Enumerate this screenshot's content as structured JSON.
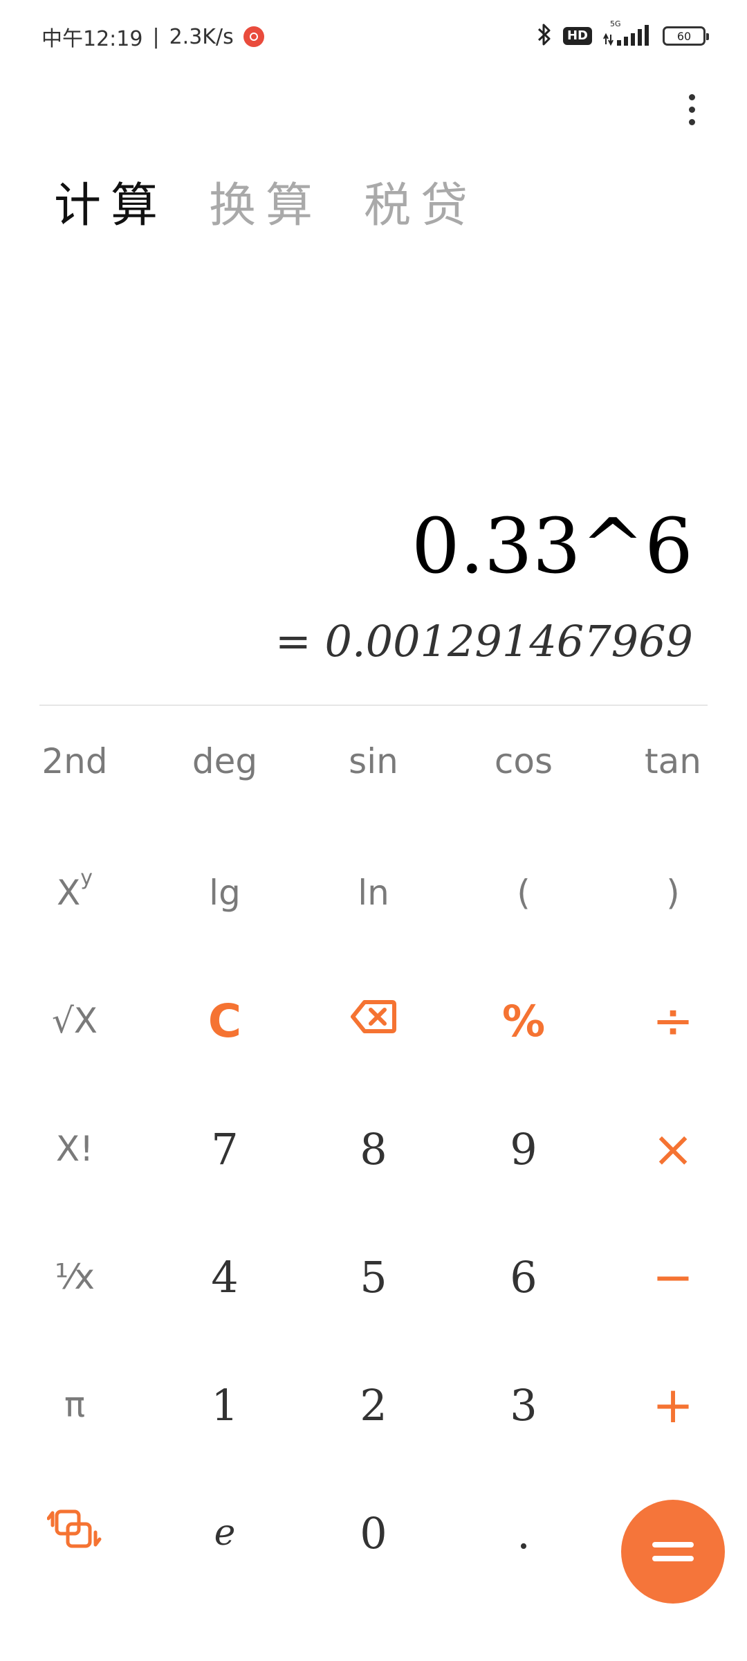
{
  "status": {
    "time": "中午12:19",
    "net_speed": "2.3K/s",
    "hd": "HD",
    "network": "5G",
    "battery": "60"
  },
  "tabs": [
    {
      "label": "计算",
      "active": true
    },
    {
      "label": "换算",
      "active": false
    },
    {
      "label": "税贷",
      "active": false
    }
  ],
  "display": {
    "expression": "0.33^6",
    "result": "= 0.001291467969"
  },
  "keys": {
    "r1": [
      "2nd",
      "deg",
      "sin",
      "cos",
      "tan"
    ],
    "r2": [
      "lg",
      "ln",
      "(",
      ")"
    ],
    "power": {
      "base": "X",
      "exp": "y"
    },
    "sqrt": "√X",
    "factorial": "X!",
    "reciprocal": "⅟x",
    "pi": "π",
    "clear": "C",
    "percent": "%",
    "divide": "÷",
    "multiply": "×",
    "minus": "−",
    "plus": "+",
    "digits": [
      "7",
      "8",
      "9",
      "4",
      "5",
      "6",
      "1",
      "2",
      "3"
    ],
    "e": "e",
    "zero": "0",
    "dot": "."
  },
  "colors": {
    "accent": "#f57332",
    "active_text": "#111111",
    "inactive_text": "#a9a9a9"
  }
}
